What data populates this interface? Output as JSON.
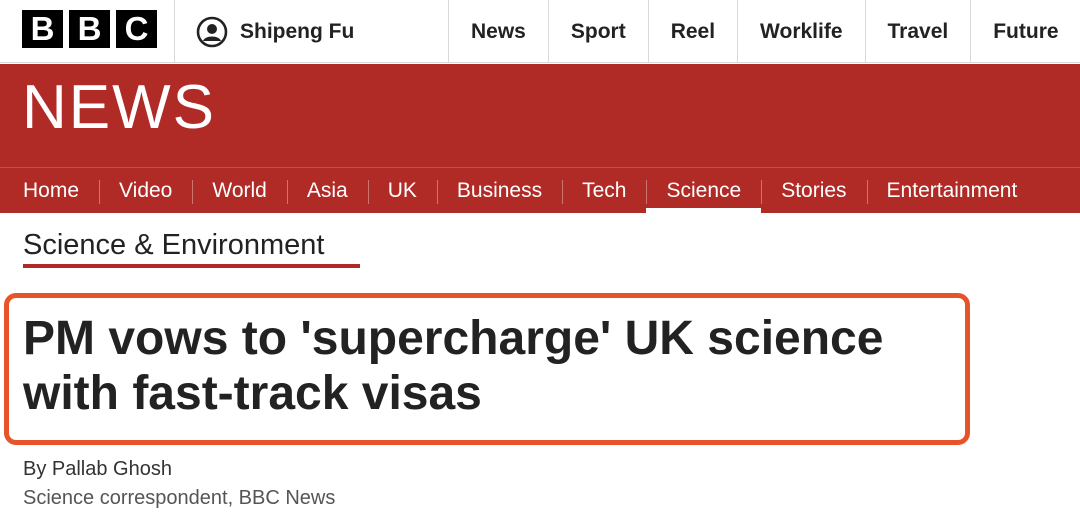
{
  "bbc_logo": {
    "letters": [
      "B",
      "B",
      "C"
    ]
  },
  "account": {
    "name": "Shipeng Fu",
    "icon": "user-account-icon"
  },
  "top_nav": [
    {
      "label": "News"
    },
    {
      "label": "Sport"
    },
    {
      "label": "Reel"
    },
    {
      "label": "Worklife"
    },
    {
      "label": "Travel"
    },
    {
      "label": "Future"
    }
  ],
  "news_banner": {
    "wordmark": "NEWS",
    "background": "#b02a26"
  },
  "news_nav": [
    {
      "label": "Home"
    },
    {
      "label": "Video"
    },
    {
      "label": "World"
    },
    {
      "label": "Asia"
    },
    {
      "label": "UK"
    },
    {
      "label": "Business"
    },
    {
      "label": "Tech"
    },
    {
      "label": "Science",
      "active": true
    },
    {
      "label": "Stories"
    },
    {
      "label": "Entertainment"
    }
  ],
  "section": {
    "title": "Science & Environment"
  },
  "article": {
    "headline": "PM vows to 'supercharge' UK science with fast-track visas",
    "highlight_color": "#e8542a",
    "byline": "By Pallab Ghosh",
    "role": "Science correspondent, BBC News"
  }
}
